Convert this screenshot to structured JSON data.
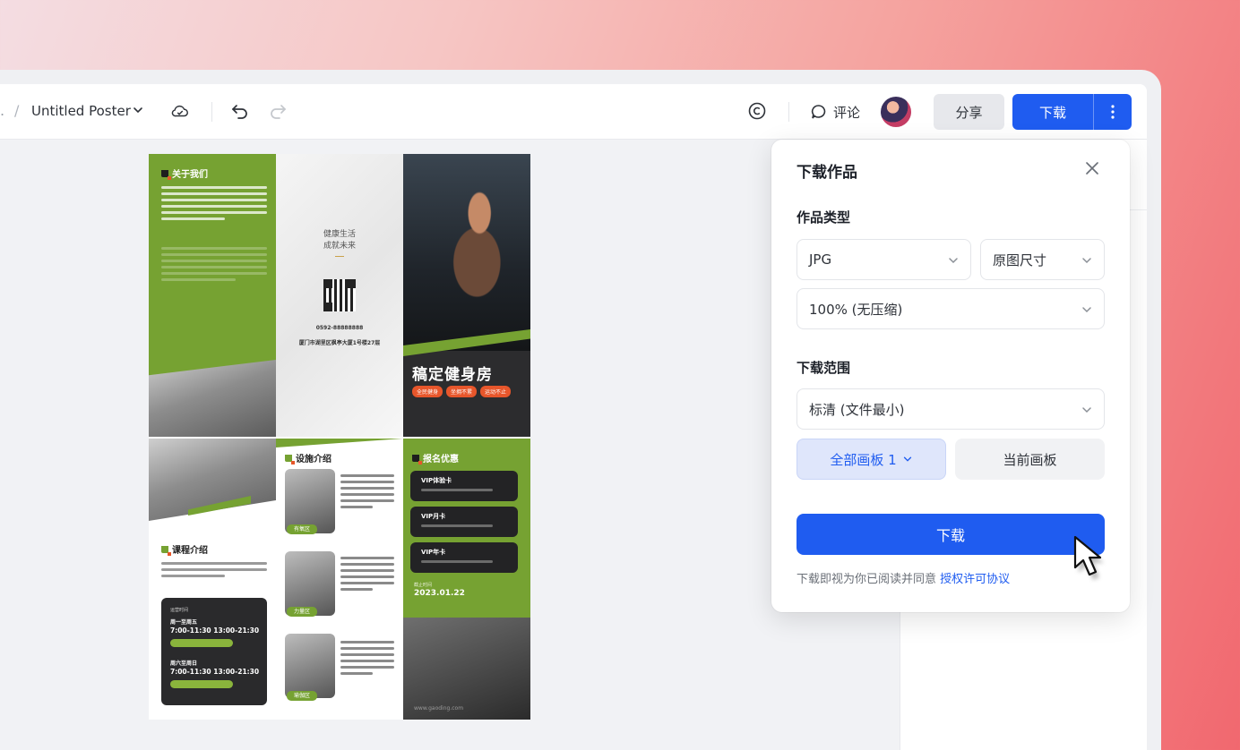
{
  "topbar": {
    "breadcrumb_prev": ".",
    "breadcrumb_slash": "/",
    "doc_title": "Untitled Poster",
    "comment_label": "评论",
    "share_label": "分享",
    "download_label": "下载"
  },
  "poster": {
    "about_title": "关于我们",
    "mid_line1": "健康生活",
    "mid_line2": "成就未来",
    "mid_phone": "0592-88888888",
    "mid_address": "厦门市湖里区枫亭大厦1号楼27层",
    "hero_title": "稿定健身房",
    "hero_tags": [
      "全民健身",
      "坐拥不累",
      "运动不止"
    ],
    "course_title": "课程介绍",
    "course_box": {
      "label": "运营时间",
      "row1_days": "周一至周五",
      "row1_time": "7:00-11:30 13:00-21:30",
      "row2_days": "周六至周日",
      "row2_time": "7:00-11:30 13:00-21:30"
    },
    "facility_title": "设施介绍",
    "facility_tags": [
      "有氧区",
      "力量区",
      "瑜伽区"
    ],
    "offer_title": "报名优惠",
    "vip_cards": [
      "VIP体验卡",
      "VIP月卡",
      "VIP年卡"
    ],
    "deadline_label": "截止时间",
    "deadline_date": "2023.01.22",
    "website": "www.gaoding.com"
  },
  "popover": {
    "title": "下载作品",
    "type_label": "作品类型",
    "format_value": "JPG",
    "size_value": "原图尺寸",
    "quality_value": "100% (无压缩)",
    "range_label": "下载范围",
    "clarity_value": "标清 (文件最小)",
    "all_pages_label": "全部画板 1",
    "current_page_label": "当前画板",
    "download_button": "下载",
    "agreement_prefix": "下载即视为你已阅读并同意",
    "agreement_link": "授权许可协议"
  },
  "colors": {
    "primary": "#1f5cf0",
    "poster_green": "#76a232",
    "poster_orange": "#e7562b"
  },
  "icons": [
    "chevron-down-icon",
    "cloud-sync-icon",
    "undo-icon",
    "redo-icon",
    "copyright-icon",
    "comment-icon",
    "more-vertical-icon",
    "close-icon",
    "cursor-icon"
  ]
}
